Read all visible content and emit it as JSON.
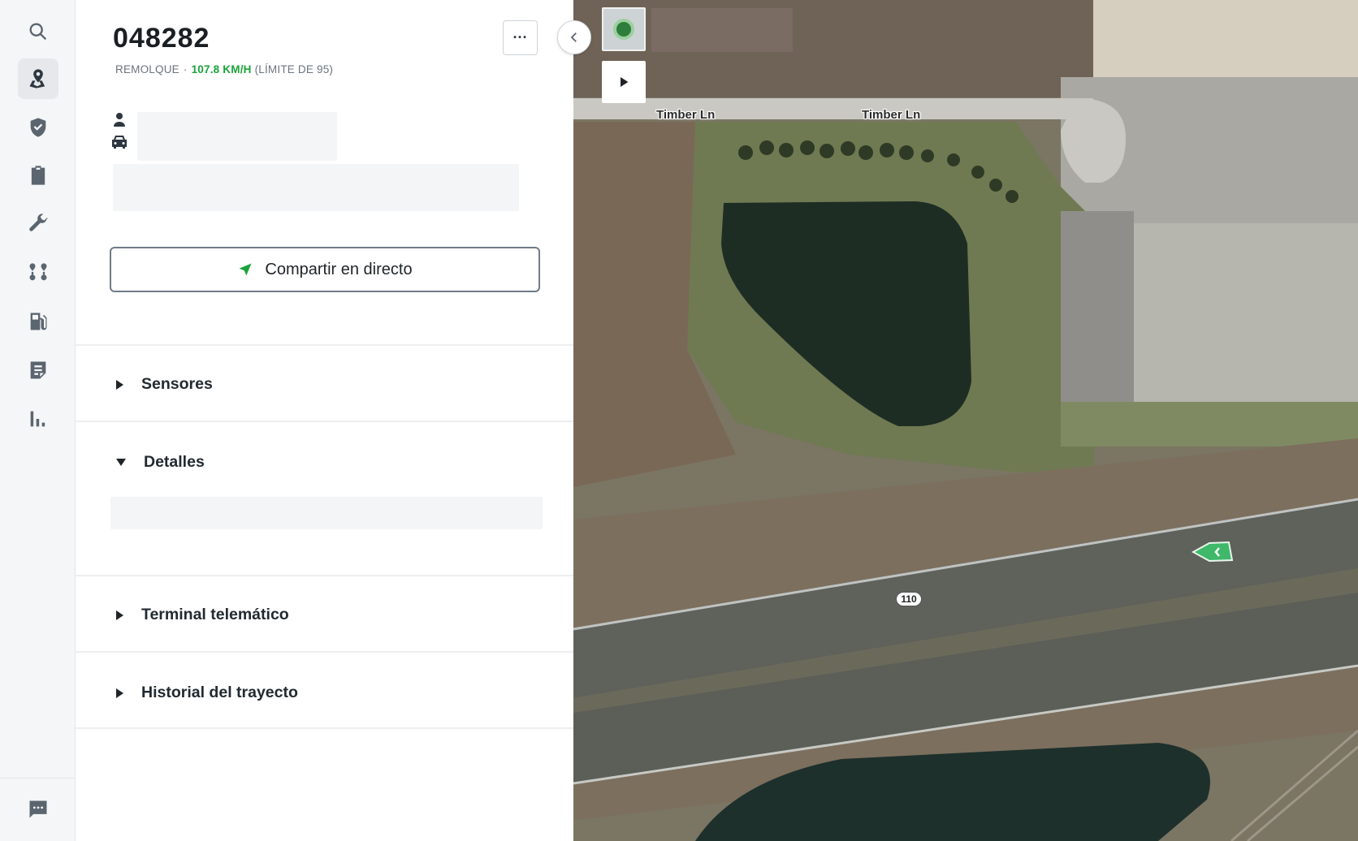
{
  "rail": {
    "items": [
      {
        "name": "search",
        "icon": "search-icon"
      },
      {
        "name": "map",
        "icon": "map-pin-icon",
        "active": true
      },
      {
        "name": "safety",
        "icon": "shield-check-icon"
      },
      {
        "name": "compliance",
        "icon": "clipboard-icon"
      },
      {
        "name": "maintenance",
        "icon": "wrench-icon"
      },
      {
        "name": "dispatch",
        "icon": "route-icon"
      },
      {
        "name": "fuel",
        "icon": "fuel-icon"
      },
      {
        "name": "documents",
        "icon": "document-icon"
      },
      {
        "name": "reports",
        "icon": "bar-chart-icon"
      }
    ],
    "feedback_icon": "chat-icon"
  },
  "vehicle": {
    "id": "048282",
    "type": "REMOLQUE",
    "separator": "·",
    "speed": "107.8 KM/H",
    "limit": "(LÍMITE DE 95)",
    "more_label": "···"
  },
  "share": {
    "label": "Compartir en directo"
  },
  "sections": {
    "sensors": "Sensores",
    "details": "Detalles",
    "telematics": "Terminal telemático",
    "trip_history": "Historial del trayecto"
  },
  "map": {
    "road_1": "Timber Ln",
    "road_2": "Timber Ln",
    "route_shield": "110"
  },
  "colors": {
    "accent_green": "#1aa33a",
    "text_dark": "#1f2428",
    "text_muted": "#6b747d",
    "rail_bg": "#f5f6f7"
  }
}
